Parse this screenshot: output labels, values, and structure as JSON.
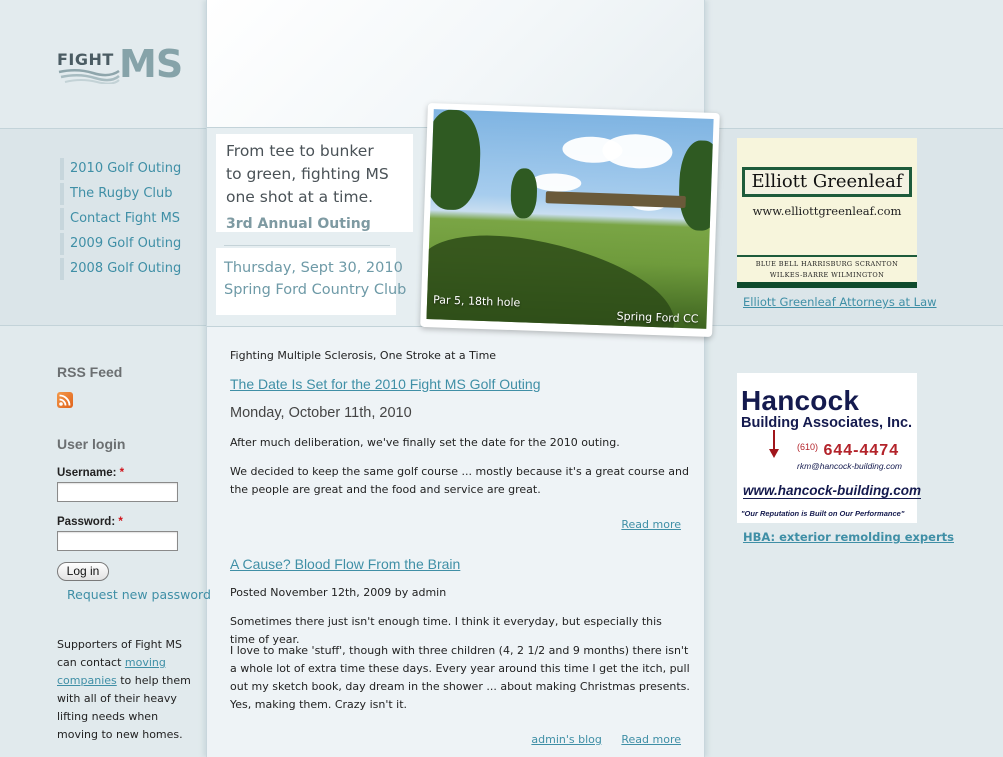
{
  "logo": {
    "fight": "FIGHT",
    "ms": "MS",
    "colors": {
      "fight": "#4b5c63",
      "ms": "#86a3a9"
    }
  },
  "nav": {
    "items": [
      {
        "label": "2010 Golf Outing"
      },
      {
        "label": "The Rugby Club"
      },
      {
        "label": "Contact Fight MS"
      },
      {
        "label": "2009 Golf Outing"
      },
      {
        "label": "2008 Golf Outing"
      }
    ]
  },
  "banner": {
    "tagline": [
      "From tee to bunker",
      "to green, fighting MS",
      "one shot at a time."
    ],
    "annual": "3rd Annual Outing",
    "date": "Thursday, Sept 30, 2010",
    "venue": "Spring Ford Country Club",
    "photo_caption_left": "Par 5, 18th hole",
    "photo_caption_right": "Spring Ford CC"
  },
  "sidebar_left": {
    "rss_title": "RSS Feed",
    "rss_icon": "rss-feed-icon",
    "login_title": "User login",
    "username_label": "Username:",
    "password_label": "Password:",
    "required_mark": "*",
    "username_value": "",
    "password_value": "",
    "login_button": "Log in",
    "request_password": "Request new password",
    "supporters_before": "Supporters of Fight MS can contact ",
    "supporters_link": "moving companies",
    "supporters_after": " to help them with all of their heavy lifting needs when moving to new homes."
  },
  "content": {
    "slogan": "Fighting Multiple Sclerosis, One Stroke at a Time",
    "posts": [
      {
        "title": "The Date Is Set for the 2010 Fight MS Golf Outing",
        "meta": "Monday, October 11th, 2010",
        "paragraphs": [
          "After much deliberation, we've finally set the date for the 2010 outing.",
          "We decided to keep the same golf course ... mostly because it's a great course and the people are great and the food and service are great."
        ],
        "links": [
          "Read more"
        ]
      },
      {
        "title": "A Cause? Blood Flow From the Brain",
        "meta": "Posted November 12th, 2009 by admin",
        "paragraphs": [
          "Sometimes there just isn't enough time. I think it everyday, but especially this time of year.",
          "I love to make 'stuff', though with three children (4, 2 1/2 and 9 months) there isn't a whole lot of extra time these days. Every year around this time I get the itch, pull out my sketch book, day dream in the shower ... about making Christmas presents. Yes, making them. Crazy isn't it."
        ],
        "links": [
          "admin's blog",
          "Read more"
        ]
      }
    ]
  },
  "sidebar_right": {
    "ads": [
      {
        "name": "Elliott Greenleaf",
        "url_text": "www.elliottgreenleaf.com",
        "cities_line1": "BLUE BELL    HARRISBURG    SCRANTON",
        "cities_line2": "WILKES-BARRE    WILMINGTON",
        "link": "Elliott Greenleaf Attorneys at Law"
      },
      {
        "name": "Hancock",
        "subname": "Building Associates, Inc.",
        "area_code": "(610)",
        "phone": "644-4474",
        "email": "rkm@hancock-building.com",
        "web": "www.hancock-building.com",
        "motto": "\"Our Reputation is Built on Our Performance\"",
        "link": "HBA: exterior remolding experts"
      }
    ]
  },
  "colors": {
    "link": "#3f8fa6",
    "background": "#e1eaed",
    "content_bg": "#eef3f6",
    "required": "#d0131b"
  }
}
